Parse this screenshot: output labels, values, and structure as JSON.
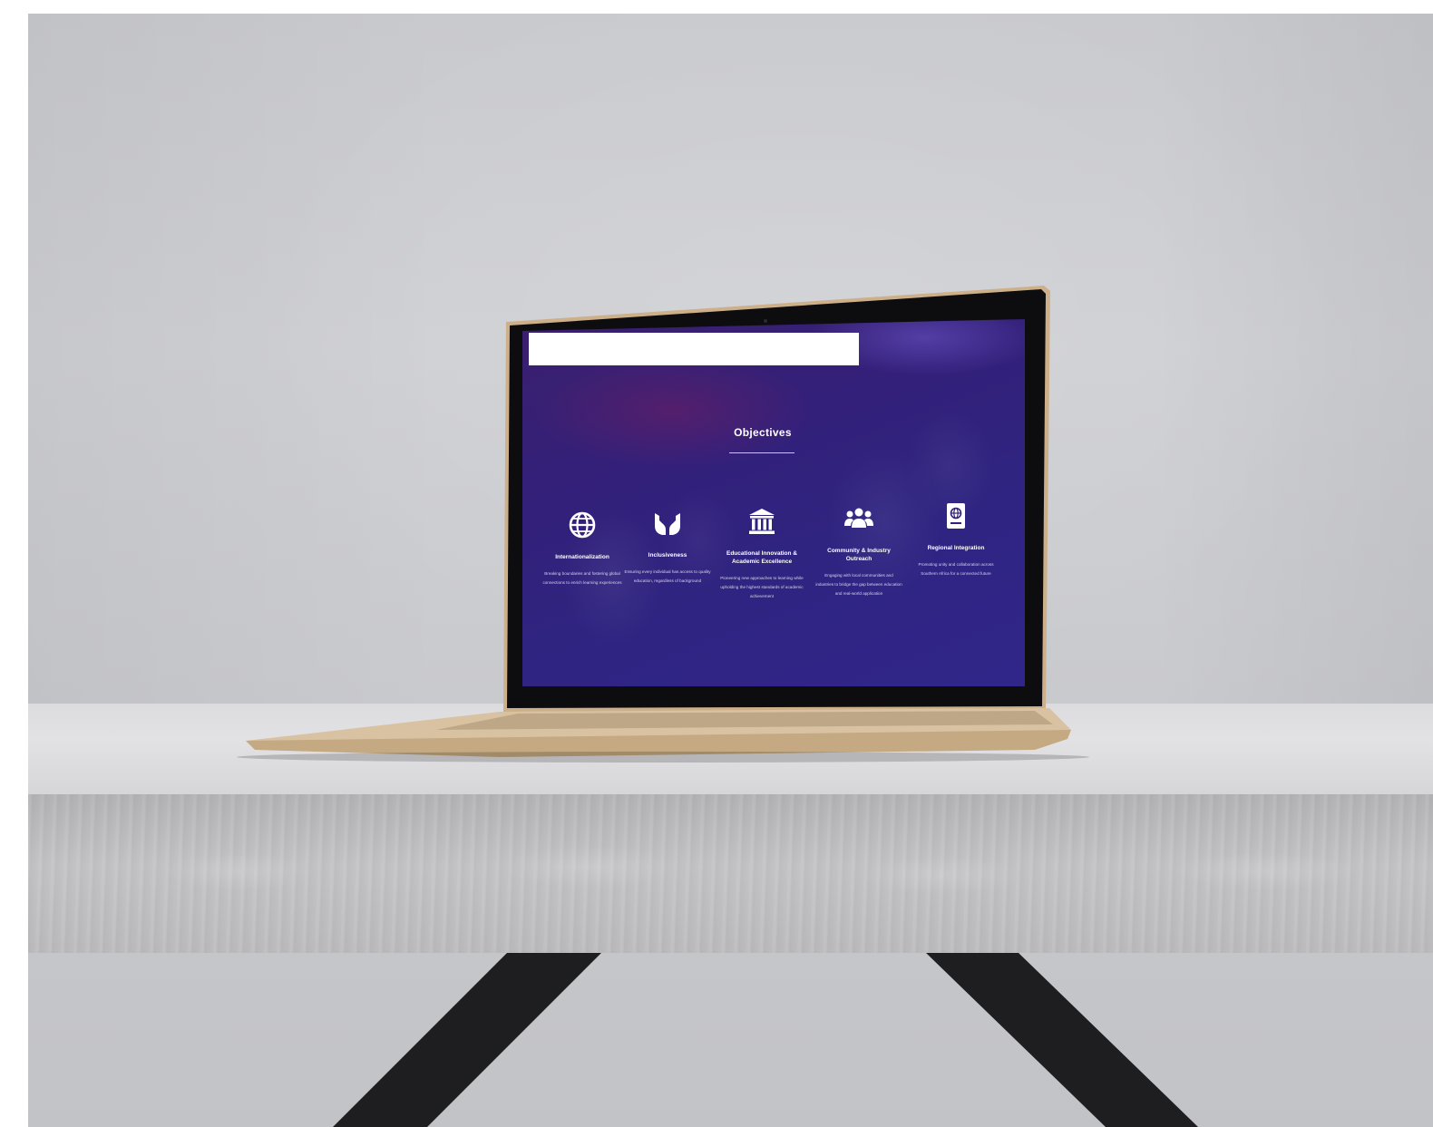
{
  "screen": {
    "section_title": "Objectives",
    "objectives": [
      {
        "icon": "globe-icon",
        "title": "Internationalization",
        "description": "Breaking boundaries and fostering global connections to enrich learning experiences"
      },
      {
        "icon": "open-hands-icon",
        "title": "Inclusiveness",
        "description": "Ensuring every individual has access to quality education, regardless of background"
      },
      {
        "icon": "institution-icon",
        "title": "Educational Innovation & Academic Excellence",
        "description": "Pioneering new approaches to learning while upholding the highest standards of academic achievement"
      },
      {
        "icon": "community-icon",
        "title": "Community & Industry Outreach",
        "description": "Engaging with local communities and industries to bridge the gap between education and real-world application"
      },
      {
        "icon": "passport-icon",
        "title": "Regional Integration",
        "description": "Promoting unity and collaboration across Southern Africa for a connected future"
      }
    ]
  },
  "colors": {
    "screen_base": "#33207a",
    "screen_accent": "#3b1f6e",
    "wall": "#c9cace",
    "table_top": "#e0e0e3",
    "table_edge": "#bcbcbf",
    "table_legs": "#1e1e20",
    "laptop_body": "#d6bfa0",
    "bezel": "#0d0d10"
  }
}
